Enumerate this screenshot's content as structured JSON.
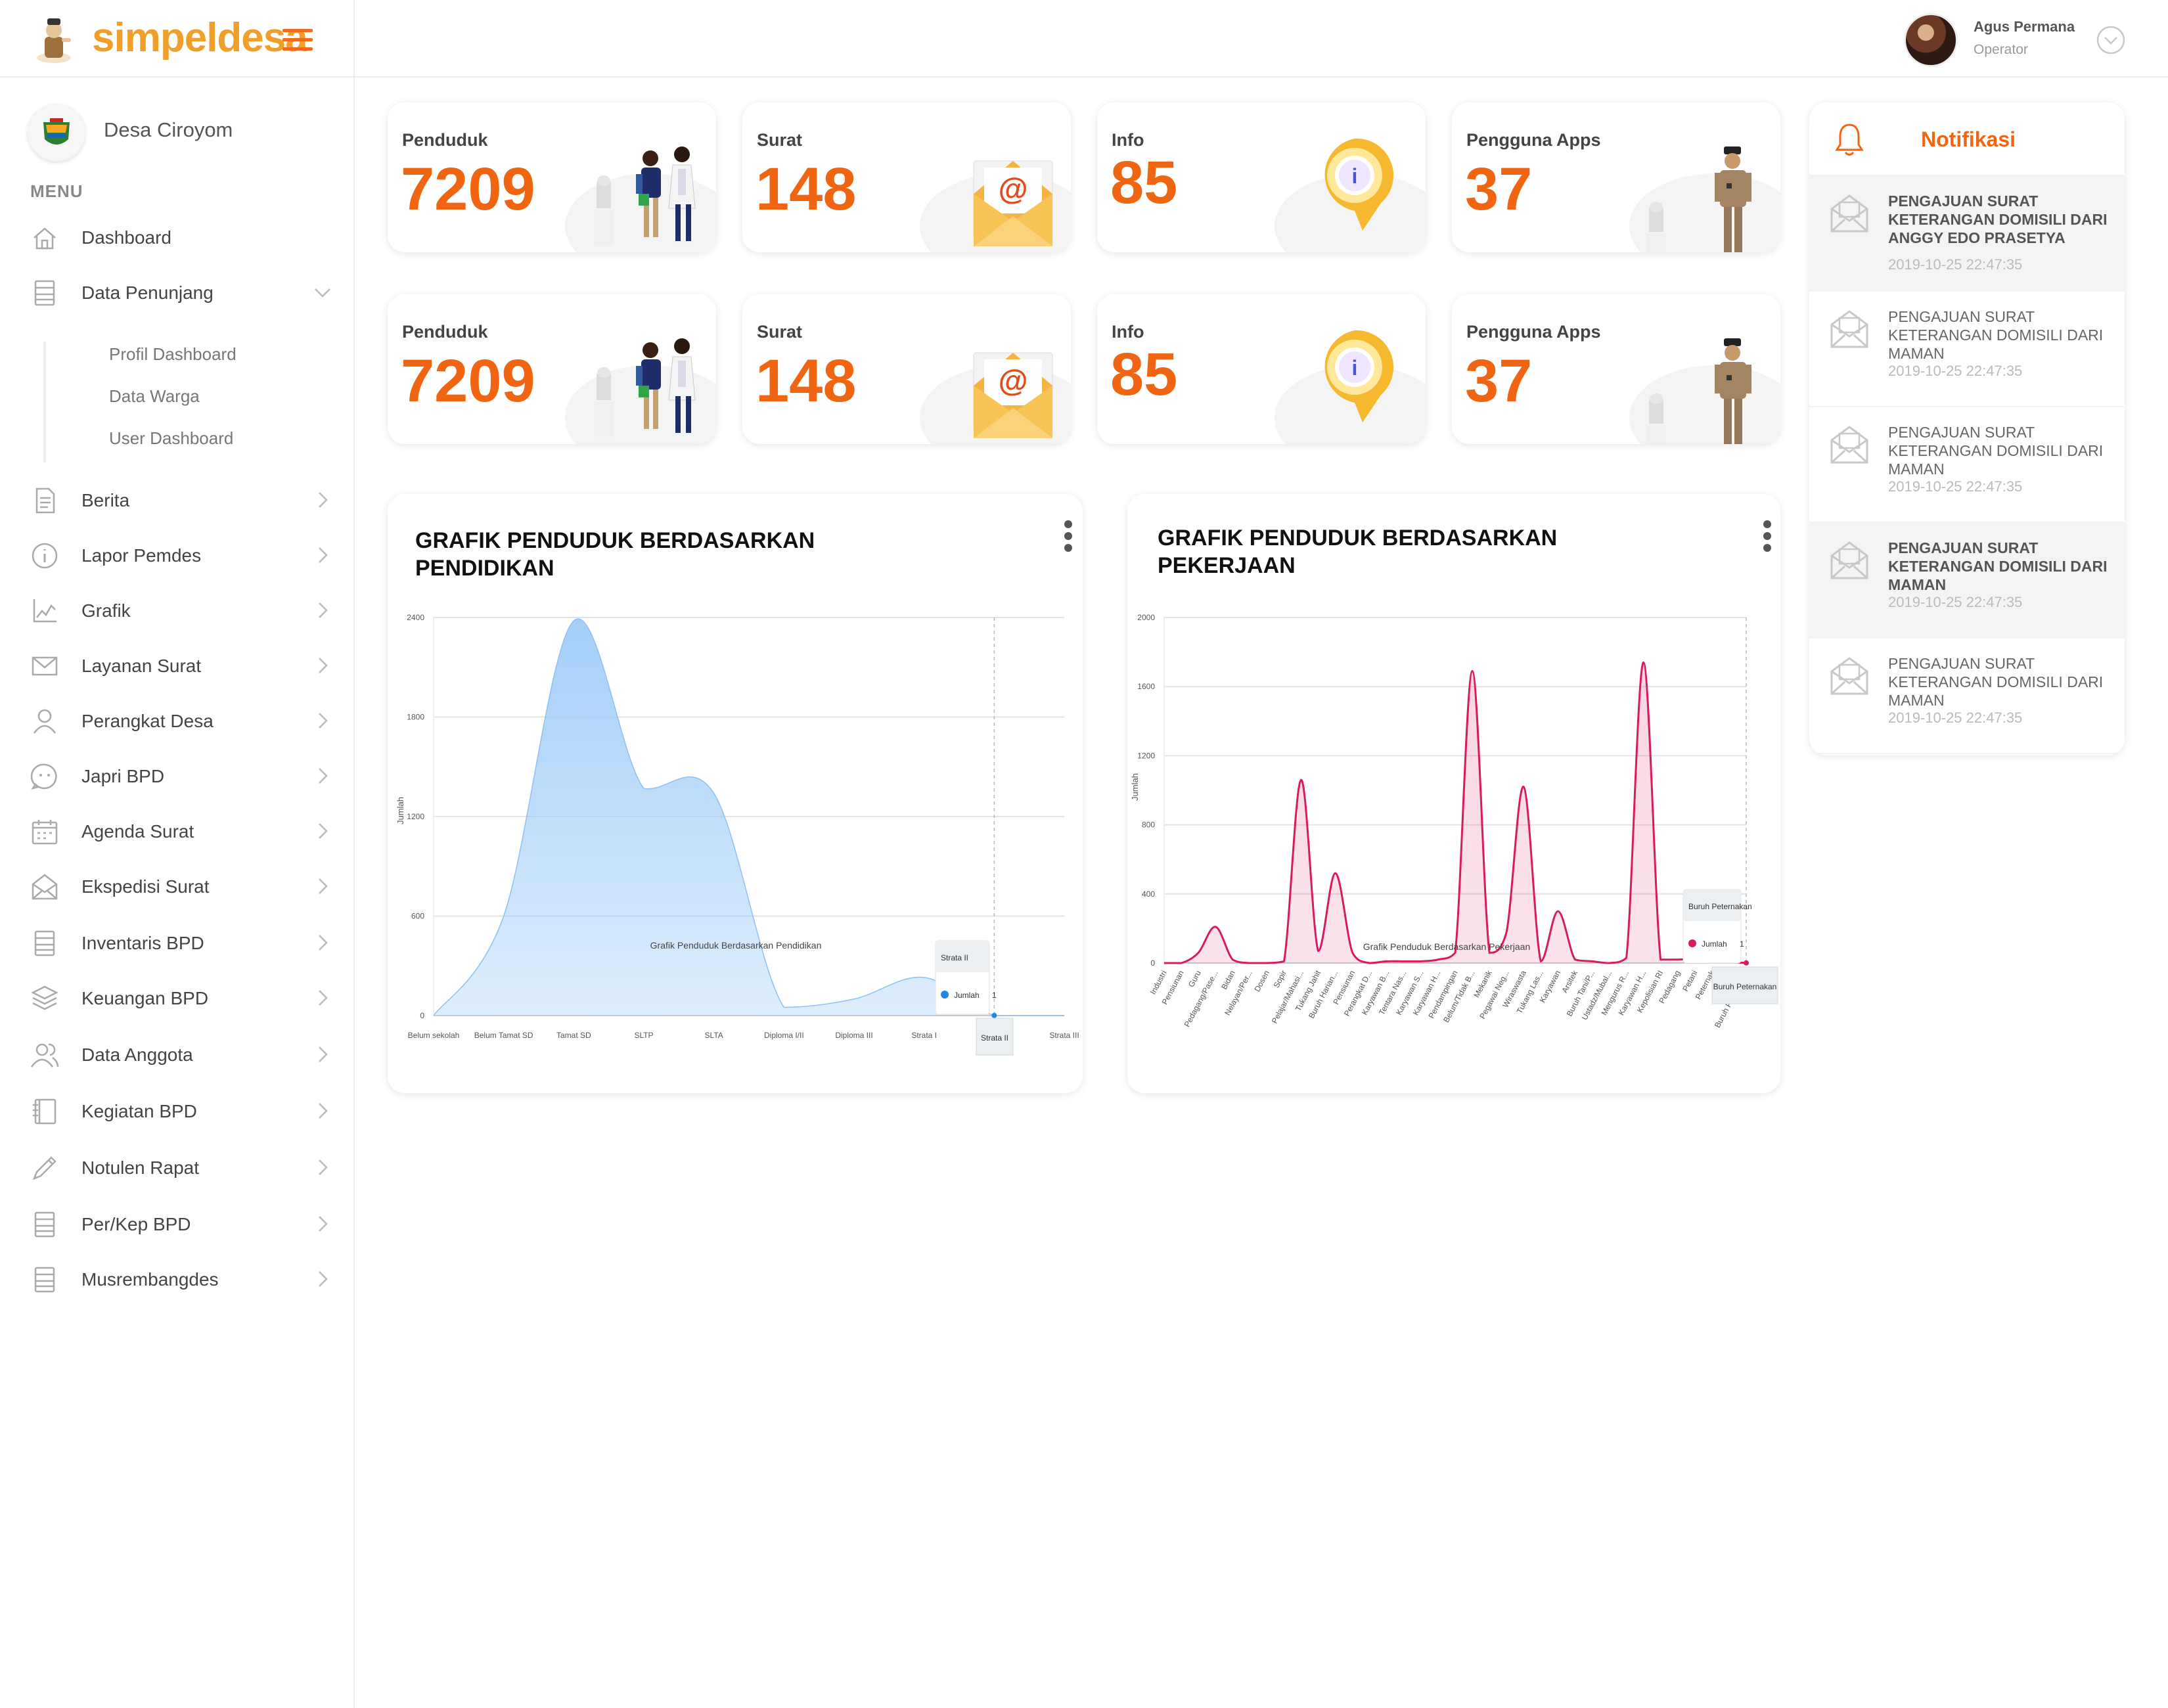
{
  "app": {
    "brand": "simpeldesa"
  },
  "user": {
    "name": "Agus Permana",
    "role": "Operator"
  },
  "village": {
    "name": "Desa Ciroyom"
  },
  "sidebar": {
    "menu_title": "MENU",
    "items": [
      {
        "label": "Dashboard",
        "icon": "home-icon"
      },
      {
        "label": "Data Penunjang",
        "icon": "list-icon",
        "expanded": true,
        "children": [
          "Profil Dashboard",
          "Data Warga",
          "User Dashboard"
        ]
      },
      {
        "label": "Berita",
        "icon": "document-icon"
      },
      {
        "label": "Lapor Pemdes",
        "icon": "info-icon"
      },
      {
        "label": "Grafik",
        "icon": "chart-icon"
      },
      {
        "label": "Layanan Surat",
        "icon": "mail-icon"
      },
      {
        "label": "Perangkat Desa",
        "icon": "user-icon"
      },
      {
        "label": "Japri BPD",
        "icon": "chat-icon"
      },
      {
        "label": "Agenda Surat",
        "icon": "calendar-icon"
      },
      {
        "label": "Ekspedisi Surat",
        "icon": "envelope-open-icon"
      },
      {
        "label": "Inventaris BPD",
        "icon": "list-icon"
      },
      {
        "label": "Keuangan BPD",
        "icon": "layers-icon"
      },
      {
        "label": "Data Anggota",
        "icon": "users-icon"
      },
      {
        "label": "Kegiatan BPD",
        "icon": "notebook-icon"
      },
      {
        "label": "Notulen Rapat",
        "icon": "pencil-icon"
      },
      {
        "label": "Per/Kep BPD",
        "icon": "list-icon"
      },
      {
        "label": "Musrembangdes",
        "icon": "list-icon"
      }
    ]
  },
  "stats": [
    {
      "label": "Penduduk",
      "value": "7209",
      "art": "doctors-illustration"
    },
    {
      "label": "Surat",
      "value": "148",
      "art": "email-envelope-illustration"
    },
    {
      "label": "Info",
      "value": "85",
      "art": "info-pin-illustration"
    },
    {
      "label": "Pengguna Apps",
      "value": "37",
      "art": "officer-illustration"
    },
    {
      "label": "Penduduk",
      "value": "7209",
      "art": "doctors-illustration"
    },
    {
      "label": "Surat",
      "value": "148",
      "art": "email-envelope-illustration"
    },
    {
      "label": "Info",
      "value": "85",
      "art": "info-pin-illustration"
    },
    {
      "label": "Pengguna Apps",
      "value": "37",
      "art": "officer-illustration"
    }
  ],
  "chart_data": [
    {
      "type": "area",
      "title": "GRAFIK PENDUDUK BERDASARKAN PENDIDIKAN",
      "subtitle": "Grafik Penduduk Berdasarkan Pendidikan",
      "ylabel": "Jumlah",
      "xlabel": "",
      "ylim": [
        0,
        2400
      ],
      "yticks": [
        0,
        600,
        1200,
        1800,
        2400
      ],
      "grid": true,
      "color": "#9fcdf8",
      "categories": [
        "Belum sekolah",
        "Belum Tamat SD",
        "Tamat SD",
        "SLTP",
        "SLTA",
        "Diploma I/II",
        "Diploma III",
        "Strata I",
        "Strata II",
        "Strata III"
      ],
      "values": [
        0,
        600,
        2380,
        1370,
        1340,
        50,
        100,
        230,
        1,
        0
      ],
      "tooltip": {
        "category": "Strata II",
        "series": "Jumlah",
        "value": 1
      }
    },
    {
      "type": "area",
      "title": "GRAFIK PENDUDUK BERDASARKAN PEKERJAAN",
      "subtitle": "Grafik Penduduk Berdasarkan Pekerjaan",
      "ylabel": "Jumlah",
      "xlabel": "",
      "ylim": [
        0,
        2000
      ],
      "yticks": [
        0,
        400,
        800,
        1200,
        1600,
        2000
      ],
      "grid": true,
      "color": "#d81b60",
      "categories": [
        "Industri",
        "Pensiunan",
        "Guru",
        "Pedagang/Pase...",
        "Bidan",
        "Nelayan/Per...",
        "Dosen",
        "Sopir",
        "Pelajar/Mahasi...",
        "Tukang Jahit",
        "Buruh Harian...",
        "Pensiunan",
        "Perangkat D...",
        "Karyawan B...",
        "Tentara Nas...",
        "Karyawan S...",
        "Karyawan H...",
        "Pendampingan",
        "Belum/Tidak B...",
        "Mekanik",
        "Pegawai Neg...",
        "Wiraswasta",
        "Tukang Las...",
        "Karyawan",
        "Arsitek",
        "Buruh Tani/P...",
        "Ustadz/Mubal...",
        "Mengurus R...",
        "Karyawan H...",
        "Kepolisian RI",
        "Pedagang",
        "Petani",
        "Peternak",
        "Ko...",
        "Buruh Peternakan"
      ],
      "values": [
        0,
        0,
        60,
        210,
        20,
        0,
        0,
        10,
        1060,
        70,
        520,
        60,
        0,
        10,
        10,
        10,
        20,
        60,
        1690,
        60,
        180,
        1020,
        10,
        300,
        20,
        10,
        0,
        30,
        1740,
        20,
        20,
        30,
        130,
        10,
        1
      ],
      "tooltip": {
        "category": "Buruh Peternakan",
        "series": "Jumlah",
        "value": 1
      }
    }
  ],
  "notifications": {
    "title": "Notifikasi",
    "items": [
      {
        "text": "PENGAJUAN SURAT KETERANGAN DOMISILI DARI ANGGY EDO PRASETYA",
        "time": "2019-10-25 22:47:35",
        "unread": true
      },
      {
        "text": "PENGAJUAN SURAT KETERANGAN DOMISILI DARI MAMAN",
        "time": "2019-10-25 22:47:35",
        "unread": false
      },
      {
        "text": "PENGAJUAN SURAT KETERANGAN DOMISILI DARI MAMAN",
        "time": "2019-10-25 22:47:35",
        "unread": false
      },
      {
        "text": "PENGAJUAN SURAT KETERANGAN DOMISILI DARI MAMAN",
        "time": "2019-10-25 22:47:35",
        "unread": true
      },
      {
        "text": "PENGAJUAN SURAT KETERANGAN DOMISILI DARI MAMAN",
        "time": "2019-10-25 22:47:35",
        "unread": false
      }
    ]
  },
  "colors": {
    "accent": "#f06511",
    "brand": "#f0a02a"
  }
}
